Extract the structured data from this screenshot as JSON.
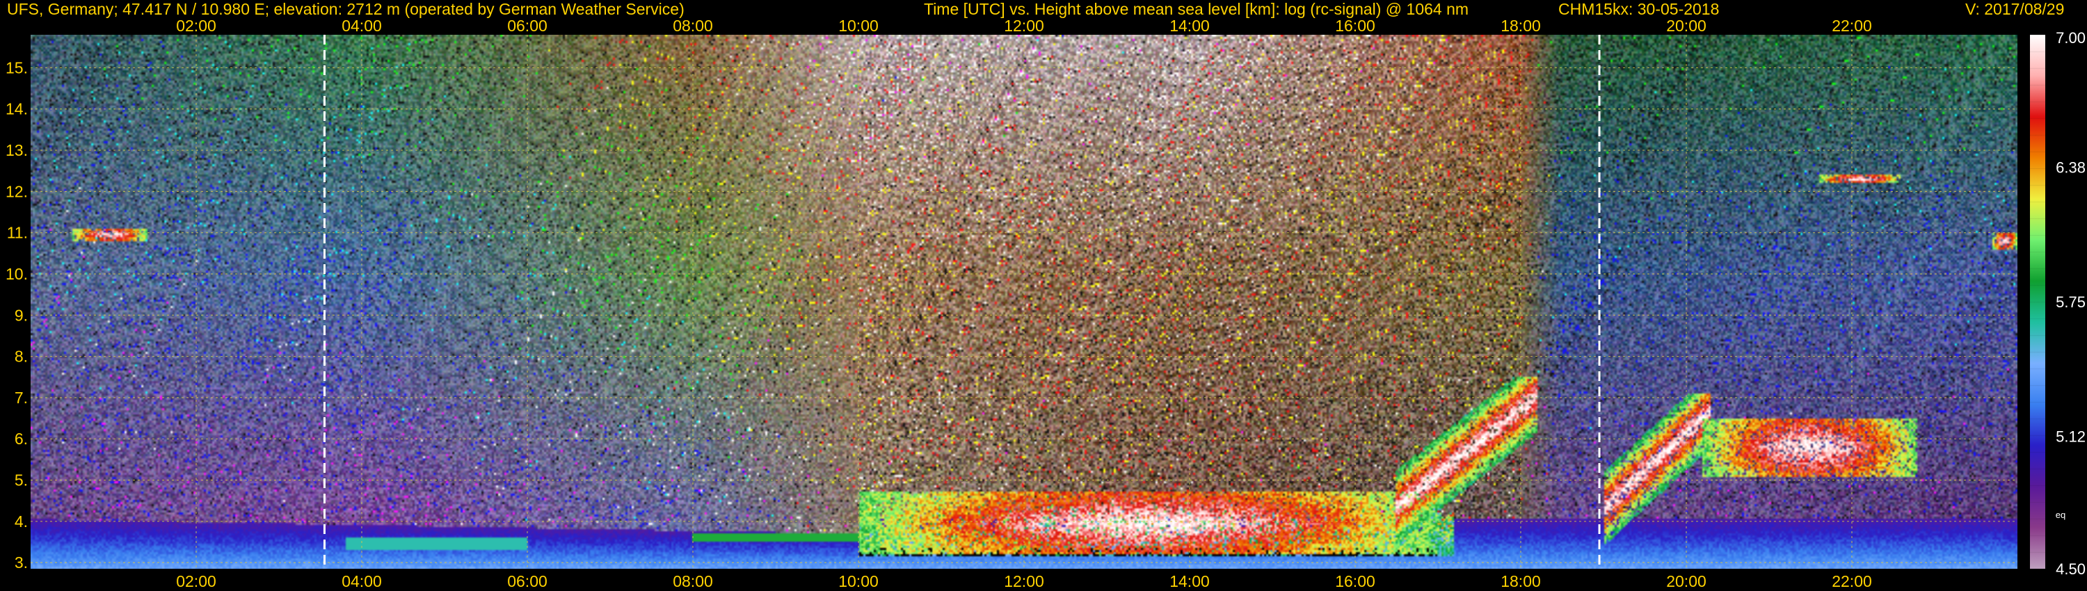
{
  "header": {
    "station_info": "UFS, Germany; 47.417 N / 10.980 E; elevation: 2712 m  (operated by German Weather Service)",
    "axes_desc": "Time [UTC] vs. Height above mean sea level [km]: log (rc-signal) @ 1064 nm",
    "instrument_date": "CHM15kx: 30-05-2018",
    "version": "V: 2017/08/29"
  },
  "colors": {
    "text": "#ffd200",
    "colorbar_text": "#ffffff",
    "grid": "#d6c84a",
    "background": "#000000",
    "marker": "#ffffff"
  },
  "chart_data": {
    "type": "heatmap",
    "title": "Time [UTC] vs. Height above mean sea level [km]: log (rc-signal) @ 1064 nm",
    "xlabel": "Time [UTC]",
    "ylabel": "Height above mean sea level [km]",
    "x_range_hours": [
      0,
      24
    ],
    "y_range_km": [
      2.85,
      15.8
    ],
    "x_ticks": [
      "02:00",
      "04:00",
      "06:00",
      "08:00",
      "10:00",
      "12:00",
      "14:00",
      "16:00",
      "18:00",
      "20:00",
      "22:00"
    ],
    "x_tick_hours": [
      2,
      4,
      6,
      8,
      10,
      12,
      14,
      16,
      18,
      20,
      22
    ],
    "y_ticks": [
      "3.",
      "4.",
      "5.",
      "6.",
      "7.",
      "8.",
      "9.",
      "10.",
      "11.",
      "12.",
      "13.",
      "14.",
      "15."
    ],
    "y_tick_km": [
      3,
      4,
      5,
      6,
      7,
      8,
      9,
      10,
      11,
      12,
      13,
      14,
      15
    ],
    "grid": true,
    "marker_lines_hours": [
      3.55,
      18.95
    ],
    "colorbar": {
      "range": [
        4.5,
        7.0
      ],
      "ticks": [
        "7.00",
        "6.38",
        "5.75",
        "5.12",
        "4.50"
      ],
      "tick_values": [
        7.0,
        6.38,
        5.75,
        5.12,
        4.5
      ],
      "extra_label": "eq",
      "stops": [
        "#bfa0bf",
        "#8a3a8a",
        "#5a1a9a",
        "#2a20c8",
        "#3a80f0",
        "#7ab0ff",
        "#20c0a0",
        "#10a030",
        "#70f070",
        "#f0f040",
        "#f08000",
        "#e01010",
        "#ffb0b0",
        "#ffffff"
      ]
    },
    "cloud_layers": [
      {
        "start_h": 0.5,
        "end_h": 1.4,
        "base_km": 10.8,
        "top_km": 11.1
      },
      {
        "start_h": 10.0,
        "end_h": 17.0,
        "base_km": 3.2,
        "top_km": 4.7
      },
      {
        "start_h": 16.5,
        "end_h": 18.2,
        "base_km": 3.0,
        "top_km": 7.5
      },
      {
        "start_h": 19.0,
        "end_h": 20.3,
        "base_km": 3.1,
        "top_km": 7.1
      },
      {
        "start_h": 20.2,
        "end_h": 22.8,
        "base_km": 5.1,
        "top_km": 6.5
      },
      {
        "start_h": 21.6,
        "end_h": 22.6,
        "base_km": 12.2,
        "top_km": 12.4
      },
      {
        "start_h": 23.7,
        "end_h": 24.0,
        "base_km": 10.6,
        "top_km": 11.0
      }
    ]
  }
}
